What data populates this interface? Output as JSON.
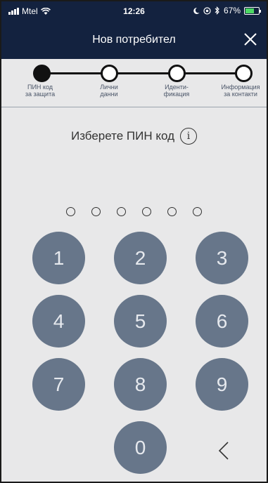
{
  "status_bar": {
    "carrier": "Mtel",
    "time": "12:26",
    "battery_percent": "67%",
    "battery_level": 0.67,
    "icons": [
      "signal-icon",
      "wifi-icon",
      "do-not-disturb-icon",
      "location-icon",
      "bluetooth-icon",
      "battery-icon"
    ]
  },
  "header": {
    "title": "Нов потребител",
    "close_icon": "close-icon"
  },
  "stepper": {
    "steps": [
      {
        "label": "ПИН код за защита",
        "line1": "ПИН код",
        "line2": "за защита",
        "active": true
      },
      {
        "label": "Лични данни",
        "line1": "Лични",
        "line2": "данни",
        "active": false
      },
      {
        "label": "Иденти-фикация",
        "line1": "Иденти-",
        "line2": "фикация",
        "active": false
      },
      {
        "label": "Информация за контакти",
        "line1": "Информация",
        "line2": "за контакти",
        "active": false
      }
    ]
  },
  "prompt": {
    "text": "Изберете ПИН код",
    "info_icon": "i"
  },
  "pin": {
    "length": 6,
    "entered": 0
  },
  "keypad": {
    "keys": [
      "1",
      "2",
      "3",
      "4",
      "5",
      "6",
      "7",
      "8",
      "9",
      "0"
    ],
    "backspace_icon": "backspace-chevron-icon"
  },
  "colors": {
    "header_bg": "#13223f",
    "screen_bg": "#e8e8e9",
    "key_bg": "#67768a",
    "key_text": "#e6e9ee"
  }
}
